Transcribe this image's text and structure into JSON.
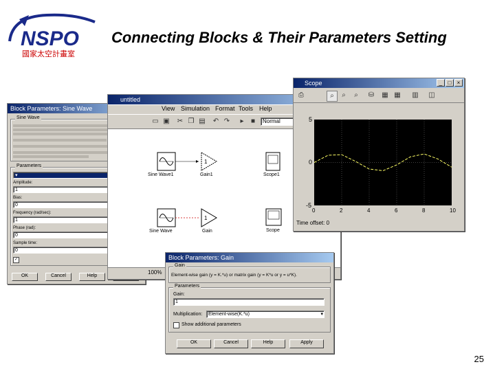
{
  "logo": {
    "text": "NSPO",
    "subtitle": "國家太空計畫室"
  },
  "slide": {
    "title": "Connecting Blocks & Their Parameters Setting",
    "page_number": "25"
  },
  "sine_dialog": {
    "title": "Block Parameters: Sine Wave",
    "section_label": "Sine Wave",
    "parameters_label": "Parameters",
    "fields": [
      {
        "label": "Amplitude:",
        "value": "1"
      },
      {
        "label": "Bias:",
        "value": "0"
      },
      {
        "label": "Frequency (rad/sec):",
        "value": "1"
      },
      {
        "label": "Phase (rad):",
        "value": "0"
      },
      {
        "label": "Sample time:",
        "value": "0"
      }
    ],
    "buttons": [
      "OK",
      "Cancel",
      "Help",
      "Apply"
    ]
  },
  "model_window": {
    "title": "untitled",
    "menus": [
      "View",
      "Simulation",
      "Format",
      "Tools",
      "Help"
    ],
    "sim_mode": "Normal",
    "zoom": "100%",
    "blocks": [
      {
        "name": "sine-wave1-block",
        "label": "Sine Wave1"
      },
      {
        "name": "gain1-block",
        "label": "Gain1",
        "value": "1"
      },
      {
        "name": "scope1-block",
        "label": "Scope1"
      },
      {
        "name": "sine-wave-block",
        "label": "Sine Wave"
      },
      {
        "name": "gain-block",
        "label": "Gain",
        "value": "1"
      },
      {
        "name": "scope-block",
        "label": "Scope"
      }
    ]
  },
  "scope_window": {
    "title": "Scope",
    "y_ticks": [
      "5",
      "0",
      "-5"
    ],
    "x_ticks": [
      "0",
      "2",
      "4",
      "6",
      "8",
      "10"
    ],
    "time_offset_label": "Time offset: 0"
  },
  "gain_dialog": {
    "title": "Block Parameters: Gain",
    "section_label": "Gain",
    "description": "Element-wise gain (y = K.*u) or matrix gain (y = K*u or y = u*K).",
    "parameters_label": "Parameters",
    "gain_label": "Gain:",
    "gain_value": "1",
    "multiplication_label": "Multiplication:",
    "multiplication_value": "Element-wise(K.*u)",
    "checkbox_label": "Show additional parameters",
    "buttons": [
      "OK",
      "Cancel",
      "Help",
      "Apply"
    ]
  },
  "chart_data": {
    "type": "line",
    "title": "",
    "xlabel": "",
    "ylabel": "",
    "xlim": [
      0,
      10
    ],
    "ylim": [
      -5,
      5
    ],
    "x": [
      0,
      1,
      2,
      3,
      4,
      5,
      6,
      7,
      8,
      9,
      10
    ],
    "series": [
      {
        "values": [
          0,
          0.84,
          0.91,
          0.14,
          -0.76,
          -0.96,
          -0.28,
          0.66,
          0.99,
          0.41,
          -0.54
        ]
      }
    ],
    "grid": true,
    "background": "#000000",
    "line_color": "#ffff66"
  }
}
